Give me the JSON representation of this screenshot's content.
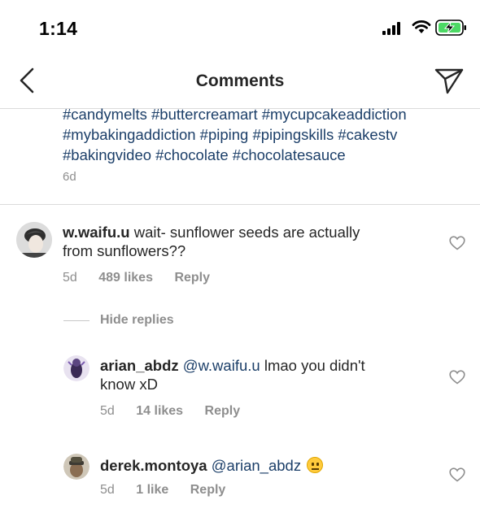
{
  "status_bar": {
    "time": "1:14"
  },
  "nav": {
    "title": "Comments"
  },
  "caption": {
    "lines": [
      "#candymelts #buttercreamart #mycupcakeaddiction",
      "#mybakingaddiction #piping #pipingskills #cakestv",
      "#bakingvideo #chocolate #chocolatesauce"
    ],
    "time": "6d"
  },
  "comments": [
    {
      "username": "w.waifu.u",
      "text_line1": "wait- sunflower seeds are actually",
      "text_line2": "from sunflowers??",
      "time": "5d",
      "likes": "489 likes",
      "reply": "Reply",
      "hide_replies": "Hide replies"
    },
    {
      "username": "arian_abdz",
      "mention": "@w.waifu.u",
      "text_line1": "lmao you didn't",
      "text_line2": "know xD",
      "time": "5d",
      "likes": "14 likes",
      "reply": "Reply"
    },
    {
      "username": "derek.montoya",
      "mention": "@arian_abdz",
      "emoji": "neutral-face",
      "time": "5d",
      "likes": "1 like",
      "reply": "Reply"
    }
  ],
  "icons": {
    "back": "chevron-left-icon",
    "send": "direct-send-icon",
    "heart": "heart-outline-icon"
  },
  "colors": {
    "hashtag": "#1c3f69",
    "meta": "#8e8e8e",
    "text": "#262626"
  }
}
